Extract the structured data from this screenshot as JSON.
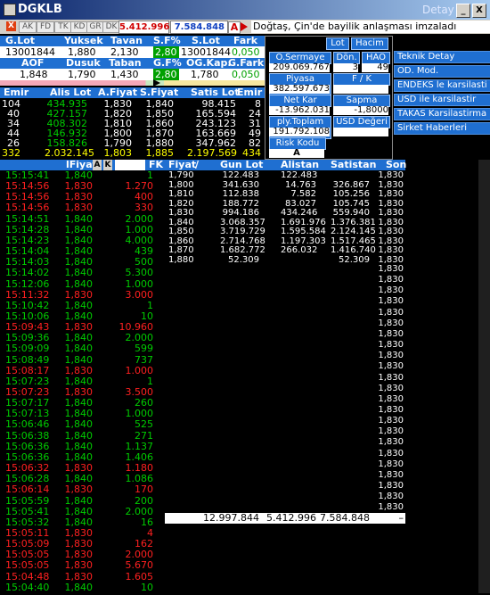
{
  "window": {
    "title": "DGKLB",
    "right_label": "Detay",
    "min": "_",
    "max": "□",
    "close": "X"
  },
  "toolbar": {
    "chips": [
      "AK",
      "FD",
      "TK",
      "KD",
      "GR",
      "DK"
    ],
    "price1": "5.412.996",
    "price2": "7.584.848",
    "a_label": "A",
    "news": "Doğtaş, Çin'de bayilik anlaşması imzaladı"
  },
  "summary1": {
    "headers": [
      "G.Lot",
      "Yuksek",
      "Tavan",
      "S.F%",
      "S.Lot",
      "Fark"
    ],
    "values": [
      "13001844",
      "1,880",
      "2,130",
      "2,80",
      "13001844",
      "0,050"
    ]
  },
  "summary2": {
    "headers": [
      "AOF",
      "Dusuk",
      "Taban",
      "G.F%",
      "OG.Kap.",
      "G.Fark"
    ],
    "values": [
      "1,848",
      "1,790",
      "1,430",
      "2,80",
      "1,780",
      "0,050"
    ]
  },
  "depth": {
    "headers": [
      "Emir",
      "Alis Lot",
      "A.Fiyat",
      "S.Fiyat",
      "Satis Lot",
      "Emir"
    ],
    "rows": [
      [
        "104",
        "434.935",
        "1,830",
        "1,840",
        "98.415",
        "8"
      ],
      [
        "40",
        "427.157",
        "1,820",
        "1,850",
        "165.594",
        "24"
      ],
      [
        "34",
        "408.302",
        "1,810",
        "1,860",
        "243.123",
        "31"
      ],
      [
        "44",
        "146.932",
        "1,800",
        "1,870",
        "163.669",
        "49"
      ],
      [
        "26",
        "158.826",
        "1,790",
        "1,880",
        "347.962",
        "82"
      ]
    ],
    "totals": [
      "332",
      "2.032.145",
      "1,803",
      "1,885",
      "2.197.569",
      "434"
    ]
  },
  "panel": {
    "lot": "Lot",
    "hacim": "Hacim",
    "o_sermaye": "O.Sermaye",
    "o_sermaye_val": "209.069.767",
    "don": "Dön.",
    "don_val": "3",
    "hao": "HAO",
    "hao_val": "49",
    "piyasa": "Piyasa Değeri",
    "piyasa_val": "382.597.673",
    "fk": "F / K",
    "fk_val": "",
    "net_kar": "Net Kar",
    "net_kar_val": "-13.962.031",
    "sapma": "Sapma",
    "sapma_val": "-1,8000",
    "ply_lot": "ply.Toplam Lot",
    "ply_lot_val": "191.792.108",
    "usd": "USD Değeri",
    "risk": "Risk Kodu",
    "risk_val": "A"
  },
  "side_buttons": [
    "Teknik Detay",
    "OD. Mod.",
    "ENDEKS le karsilasti",
    "USD ile karsilastir",
    "TAKAS Karsilastirma",
    "Sirket Haberleri"
  ],
  "ticks": {
    "headers": [
      "lFiyat",
      "A",
      "K",
      "FK"
    ],
    "rows": [
      [
        "15:15:41",
        "1,840",
        "1",
        "g"
      ],
      [
        "15:14:56",
        "1,830",
        "1.270",
        "r"
      ],
      [
        "15:14:56",
        "1,830",
        "400",
        "r"
      ],
      [
        "15:14:56",
        "1,830",
        "330",
        "r"
      ],
      [
        "15:14:51",
        "1,840",
        "2.000",
        "g"
      ],
      [
        "15:14:28",
        "1,840",
        "1.000",
        "g"
      ],
      [
        "15:14:23",
        "1,840",
        "4.000",
        "g"
      ],
      [
        "15:14:04",
        "1,840",
        "439",
        "g"
      ],
      [
        "15:14:03",
        "1,840",
        "500",
        "g"
      ],
      [
        "15:14:02",
        "1,840",
        "5.300",
        "g"
      ],
      [
        "15:12:06",
        "1,840",
        "1.000",
        "g"
      ],
      [
        "15:11:32",
        "1,830",
        "3.000",
        "r"
      ],
      [
        "15:10:42",
        "1,840",
        "1",
        "g"
      ],
      [
        "15:10:06",
        "1,840",
        "10",
        "g"
      ],
      [
        "15:09:43",
        "1,830",
        "10.960",
        "r"
      ],
      [
        "15:09:36",
        "1,840",
        "2.000",
        "g"
      ],
      [
        "15:09:09",
        "1,840",
        "599",
        "g"
      ],
      [
        "15:08:49",
        "1,840",
        "737",
        "g"
      ],
      [
        "15:08:17",
        "1,830",
        "1.000",
        "r"
      ],
      [
        "15:07:23",
        "1,840",
        "1",
        "g"
      ],
      [
        "15:07:23",
        "1,830",
        "3.500",
        "r"
      ],
      [
        "15:07:17",
        "1,840",
        "260",
        "g"
      ],
      [
        "15:07:13",
        "1,840",
        "1.000",
        "g"
      ],
      [
        "15:06:46",
        "1,840",
        "525",
        "g"
      ],
      [
        "15:06:38",
        "1,840",
        "271",
        "g"
      ],
      [
        "15:06:36",
        "1,840",
        "1.137",
        "g"
      ],
      [
        "15:06:36",
        "1,840",
        "1.406",
        "g"
      ],
      [
        "15:06:32",
        "1,830",
        "1.180",
        "r"
      ],
      [
        "15:06:28",
        "1,840",
        "1.086",
        "g"
      ],
      [
        "15:06:14",
        "1,830",
        "170",
        "r"
      ],
      [
        "15:05:59",
        "1,840",
        "200",
        "g"
      ],
      [
        "15:05:41",
        "1,840",
        "2.000",
        "g"
      ],
      [
        "15:05:32",
        "1,840",
        "16",
        "g"
      ],
      [
        "15:05:11",
        "1,830",
        "4",
        "r"
      ],
      [
        "15:05:09",
        "1,830",
        "162",
        "r"
      ],
      [
        "15:05:05",
        "1,830",
        "2.000",
        "r"
      ],
      [
        "15:05:05",
        "1,830",
        "5.670",
        "r"
      ],
      [
        "15:04:48",
        "1,830",
        "1.605",
        "r"
      ],
      [
        "15:04:40",
        "1,840",
        "10",
        "g"
      ]
    ]
  },
  "orderbook": {
    "headers": [
      "Fiyat",
      "Gun Lot",
      "Alistan",
      "Satistan",
      "Son"
    ],
    "rows": [
      [
        "1,790",
        "122.483",
        "122.483",
        "",
        "1,830"
      ],
      [
        "1,800",
        "341.630",
        "14.763",
        "326.867",
        "1,830"
      ],
      [
        "1,810",
        "112.838",
        "7.582",
        "105.256",
        "1,830"
      ],
      [
        "1,820",
        "188.772",
        "83.027",
        "105.745",
        "1,830"
      ],
      [
        "1,830",
        "994.186",
        "434.246",
        "559.940",
        "1,830"
      ],
      [
        "1,840",
        "3.068.357",
        "1.691.976",
        "1.376.381",
        "1,830"
      ],
      [
        "1,850",
        "3.719.729",
        "1.595.584",
        "2.124.145",
        "1,830"
      ],
      [
        "1,860",
        "2.714.768",
        "1.197.303",
        "1.517.465",
        "1,830"
      ],
      [
        "1,870",
        "1.682.772",
        "266.032",
        "1.416.740",
        "1,830"
      ],
      [
        "1,880",
        "52.309",
        "",
        "52.309",
        "1,830"
      ]
    ],
    "son_extra": [
      "1,830",
      "1,830",
      "1,830",
      "1,830",
      "1,830",
      "1,830",
      "1,830",
      "1,830",
      "1,830",
      "1,830",
      "1,830",
      "1,830",
      "1,830",
      "1,830",
      "1,830",
      "1,830",
      "1,830",
      "1,830",
      "1,830",
      "1,830",
      "1,830",
      "1,830",
      "1,830",
      "1,830",
      "1,830",
      "1,830",
      "1,830",
      "1,830",
      "1,830"
    ],
    "totals": [
      "12.997.844",
      "5.412.996",
      "7.584.848",
      "–"
    ]
  }
}
